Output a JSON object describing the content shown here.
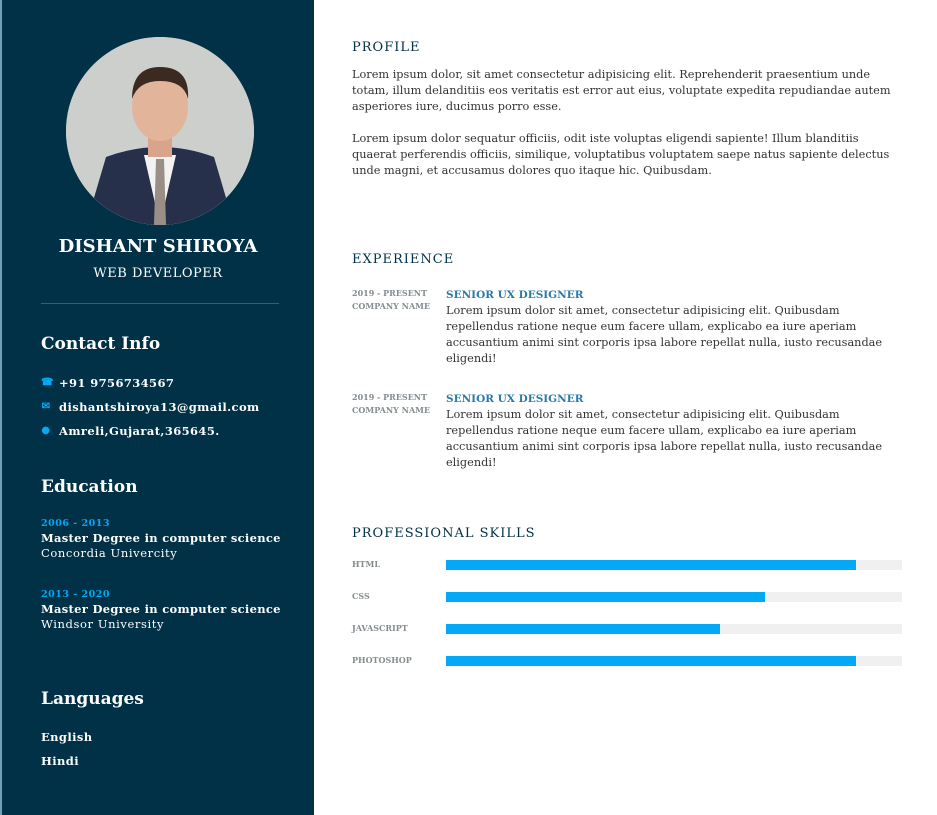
{
  "sidebar": {
    "name": "DISHANT SHIROYA",
    "role": "WEB  DEVELOPER",
    "contact_title": "Contact Info",
    "contact": [
      {
        "icon": "phone-icon",
        "text": "+91 9756734567"
      },
      {
        "icon": "mail-icon",
        "text": "dishantshiroya13@gmail.com"
      },
      {
        "icon": "location-icon",
        "text": "Amreli,Gujarat,365645."
      }
    ],
    "education_title": "Education",
    "education": [
      {
        "years": "2006 - 2013",
        "degree": "Master Degree in computer science",
        "school": "Concordia Univercity"
      },
      {
        "years": "2013 - 2020",
        "degree": "Master Degree in computer science",
        "school": "Windsor University"
      }
    ],
    "languages_title": "Languages",
    "languages": [
      "English",
      "Hindi"
    ]
  },
  "main": {
    "profile_title": "PROFILE",
    "profile": [
      "Lorem ipsum dolor, sit amet consectetur adipisicing elit. Reprehenderit praesentium unde totam, illum delanditiis eos veritatis est error aut eius, voluptate expedita repudiandae autem asperiores iure, ducimus porro esse.",
      "Lorem ipsum dolor sequatur officiis, odit iste voluptas eligendi sapiente! Illum blanditiis quaerat perferendis officiis, similique, voluptatibus voluptatem saepe natus sapiente delectus unde magni, et accusamus dolores quo itaque hic. Quibusdam."
    ],
    "experience_title": "EXPERIENCE",
    "experience": [
      {
        "period": "2019 - PRESENT",
        "company": "COMPANY NAME",
        "job": "SENIOR UX DESIGNER",
        "desc": "Lorem ipsum dolor sit amet, consectetur adipisicing elit. Quibusdam repellendus ratione neque eum facere ullam, explicabo ea iure aperiam accusantium animi sint corporis ipsa labore repellat nulla, iusto recusandae eligendi!"
      },
      {
        "period": "2019 - PRESENT",
        "company": "COMPANY NAME",
        "job": "SENIOR UX DESIGNER",
        "desc": "Lorem ipsum dolor sit amet, consectetur adipisicing elit. Quibusdam repellendus ratione neque eum facere ullam, explicabo ea iure aperiam accusantium animi sint corporis ipsa labore repellat nulla, iusto recusandae eligendi!"
      }
    ],
    "skills_title": "PROFESSIONAL SKILLS",
    "skills": [
      {
        "name": "HTML",
        "percent": 90
      },
      {
        "name": "CSS",
        "percent": 70
      },
      {
        "name": "JAVASCRIPT",
        "percent": 60
      },
      {
        "name": "PHOTOSHOP",
        "percent": 90
      }
    ]
  },
  "colors": {
    "sidebar": "#003147",
    "accent": "#03a9f4"
  }
}
